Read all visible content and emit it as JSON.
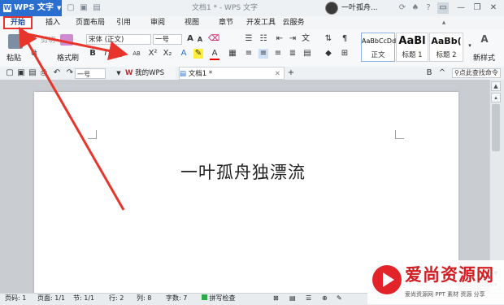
{
  "app": {
    "name": "WPS 文字",
    "logo_letter": "W"
  },
  "window": {
    "title": "文档1 * - WPS 文字",
    "user": "一叶孤舟..."
  },
  "ribbon_tabs": [
    "开始",
    "插入",
    "页面布局",
    "引用",
    "审阅",
    "视图",
    "章节",
    "开发工具",
    "云服务"
  ],
  "ribbon": {
    "paste_label": "粘贴",
    "cut_label": "剪切",
    "format_painter_label": "格式刷",
    "font_name": "宋体 (正文)",
    "font_size": "一号",
    "styles": [
      {
        "preview": "AaBbCcDd",
        "label": "正文"
      },
      {
        "preview": "AaBl",
        "label": "标题 1"
      },
      {
        "preview": "AaBb(",
        "label": "标题 2"
      }
    ],
    "new_style_label": "新样式"
  },
  "quickbar": {
    "style_select": "一号",
    "tabs": [
      {
        "label": "我的WPS"
      },
      {
        "label": "文档1 *"
      }
    ],
    "search_label": "点此查找命令"
  },
  "document": {
    "text": "一叶孤舟独漂流"
  },
  "status": {
    "page_code": "页码: 1",
    "page": "页面: 1/1",
    "section": "节: 1/1",
    "row": "行: 2",
    "col": "列: 8",
    "chars": "字数: 7",
    "spell_check": "拼写检查"
  },
  "watermark": {
    "title": "爱尚资源网",
    "subtitle": "爱尚资源网 PPT 素材 资源 分享"
  },
  "colors": {
    "accent": "#2a6fd0",
    "highlight": "#e8352c",
    "annotation_arrow": "#e8352c"
  }
}
